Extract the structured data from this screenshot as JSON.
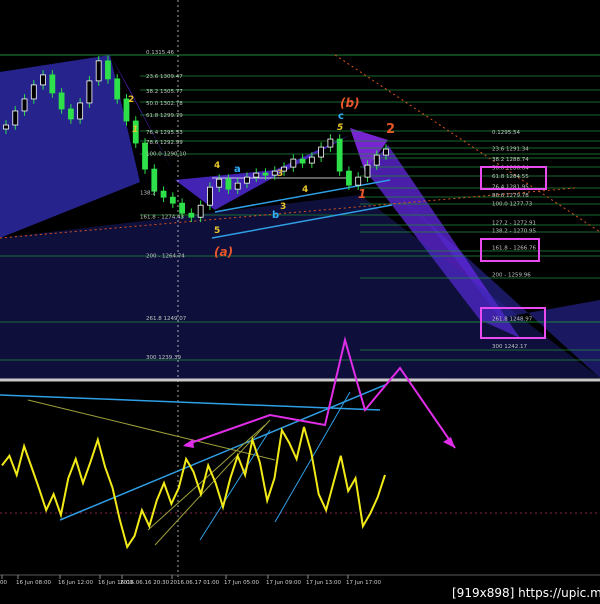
{
  "chart_data": [
    {
      "type": "line",
      "title": "",
      "xlabel": "",
      "ylabel": "",
      "x_ticks": [
        "00",
        "16 Jun 08:00",
        "16 Jun 12:00",
        "16 Jun 16:00",
        "2016.06.16 20:30",
        "2016.06.17 01:00",
        "17 Jun 05:00",
        "17 Jun 09:00",
        "17 Jun 13:00",
        "17 Jun 17:00"
      ],
      "series": [
        {
          "values": [
            1298.0,
            1301.5,
            1304.5,
            1308.0,
            1310.5,
            1306.0,
            1302.0,
            1299.5,
            1303.5,
            1309.0,
            1314.0,
            1309.5,
            1304.5,
            1299.0,
            1293.5,
            1287.0,
            1281.5,
            1280.0,
            1278.5,
            1276.0,
            1275.0,
            1278.0,
            1282.5,
            1284.5,
            1282.0,
            1283.5,
            1285.0,
            1286.0,
            1285.5,
            1286.5,
            1287.5,
            1289.5,
            1288.5,
            1290.0,
            1292.5,
            1294.5,
            1286.5,
            1283.0,
            1285.0,
            1288.0,
            1290.5,
            1292.0
          ]
        }
      ],
      "price_levels": [
        {
          "text": "0.1315.46",
          "value": 1315.46
        },
        {
          "text": "23.6 1309.47",
          "value": 1309.47
        },
        {
          "text": "38.2 1305.77",
          "value": 1305.77
        },
        {
          "text": "50.0 1302.78",
          "value": 1302.78
        },
        {
          "text": "61.8 1299.79",
          "value": 1299.79
        },
        {
          "text": "76.4 1295.53",
          "value": 1295.53
        },
        {
          "text": "78.6 1292.99",
          "value": 1292.99
        },
        {
          "text": "100.0 1290.10",
          "value": 1290.1
        },
        {
          "text": "138.2",
          "value": 1280.4
        },
        {
          "text": "161.8 - 1274.43",
          "value": 1274.43
        },
        {
          "text": "200 - 1264.74",
          "value": 1264.74
        },
        {
          "text": "261.8 1249.07",
          "value": 1249.07
        },
        {
          "text": "300 1239.39",
          "value": 1239.39
        },
        {
          "text": "0.1295.54",
          "value": 1295.54
        },
        {
          "text": "23.6 1291.34",
          "value": 1291.34
        },
        {
          "text": "38.2 1288.74",
          "value": 1288.74
        },
        {
          "text": "50.0 1286.64",
          "value": 1286.64
        },
        {
          "text": "61.8 1284.55",
          "value": 1284.55
        },
        {
          "text": "76.4 1281.95",
          "value": 1281.95
        },
        {
          "text": "86.6 1279.78",
          "value": 1279.78
        },
        {
          "text": "100.0 1277.73",
          "value": 1277.73
        },
        {
          "text": "127.2 - 1272.91",
          "value": 1272.91
        },
        {
          "text": "138.2 - 1270.95",
          "value": 1270.95
        },
        {
          "text": "161.8 - 1266.76",
          "value": 1266.76
        },
        {
          "text": "200 - 1259.96",
          "value": 1259.96
        },
        {
          "text": "261.8 1248.97",
          "value": 1248.97
        },
        {
          "text": "300 1242.17",
          "value": 1242.17
        }
      ],
      "wave_labels": [
        "(b)",
        "c",
        "5",
        "2",
        "1",
        "(a)",
        "a",
        "b",
        "4",
        "3",
        "5",
        "2",
        "1",
        "4",
        "3"
      ],
      "grid": false
    },
    {
      "type": "line",
      "title": "",
      "series": [
        {
          "values": [
            44,
            38,
            50,
            32,
            45,
            58,
            72,
            62,
            75,
            52,
            40,
            55,
            42,
            28,
            45,
            58,
            78,
            95,
            88,
            72,
            82,
            66,
            55,
            68,
            58,
            40,
            48,
            62,
            44,
            55,
            70,
            52,
            38,
            50,
            28,
            42,
            66,
            52,
            22,
            30,
            40,
            20,
            36,
            62,
            72,
            55,
            38,
            60,
            52,
            82,
            74,
            64,
            50
          ]
        }
      ]
    }
  ],
  "watermark": "[919x898] https://upic.me/"
}
